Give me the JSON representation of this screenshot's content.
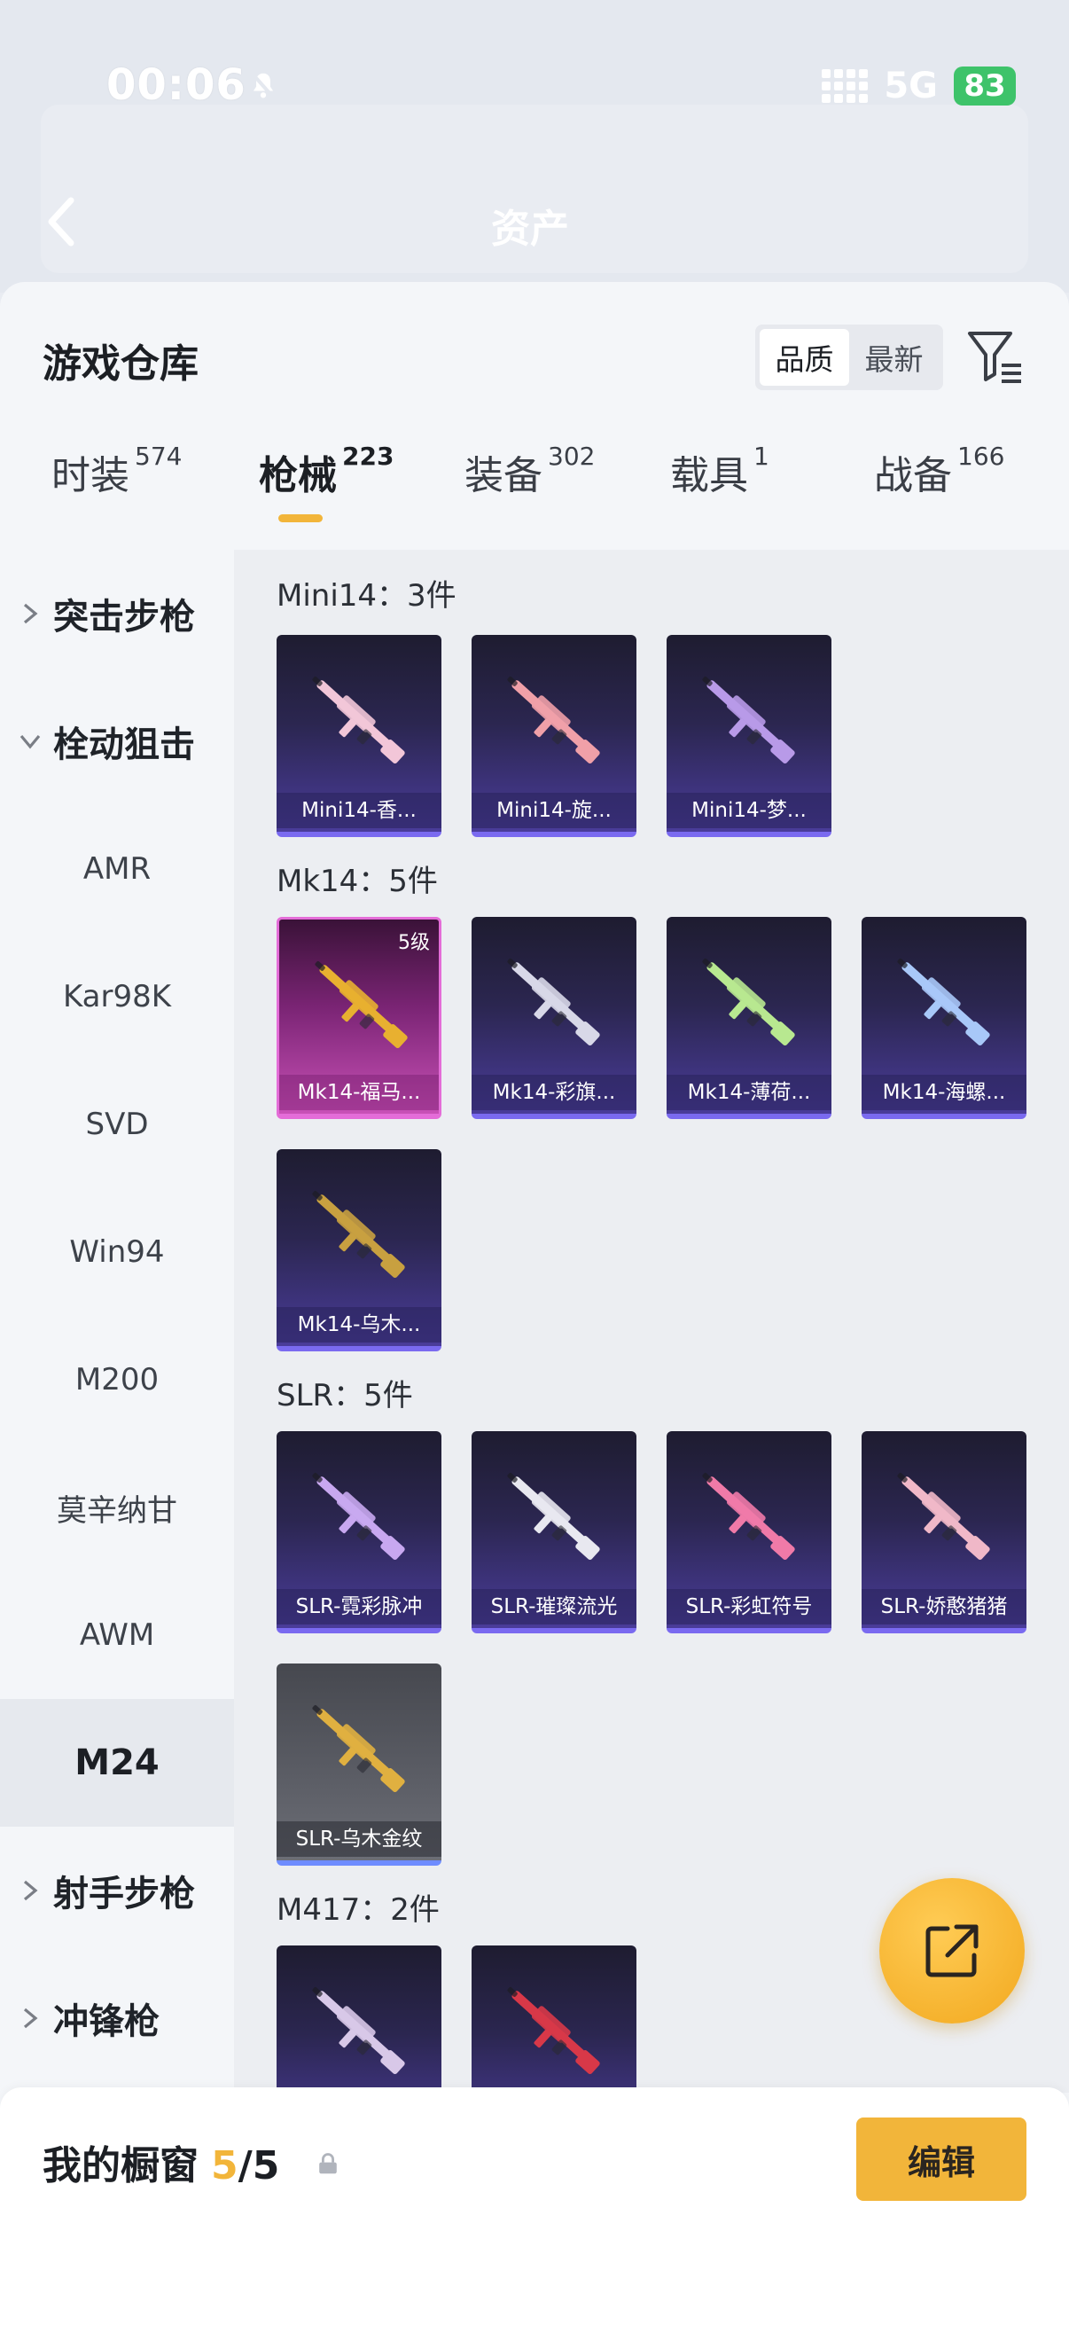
{
  "status_bar": {
    "time": "00:06",
    "network": "5G",
    "battery": "83"
  },
  "background": {
    "page_title": "资产"
  },
  "sheet": {
    "title": "游戏仓库",
    "sort": {
      "options": [
        "品质",
        "最新"
      ],
      "active": "品质"
    }
  },
  "tabs": [
    {
      "label": "时装",
      "count": "574"
    },
    {
      "label": "枪械",
      "count": "223",
      "active": true
    },
    {
      "label": "装备",
      "count": "302"
    },
    {
      "label": "载具",
      "count": "1"
    },
    {
      "label": "战备",
      "count": "166"
    }
  ],
  "sidebar": {
    "items": [
      {
        "label": "突击步枪",
        "type": "group",
        "expanded": false
      },
      {
        "label": "栓动狙击",
        "type": "group",
        "expanded": true
      },
      {
        "label": "AMR"
      },
      {
        "label": "Kar98K"
      },
      {
        "label": "SVD"
      },
      {
        "label": "Win94"
      },
      {
        "label": "M200"
      },
      {
        "label": "莫辛纳甘"
      },
      {
        "label": "AWM"
      },
      {
        "label": "M24",
        "selected": true
      },
      {
        "label": "射手步枪",
        "type": "group",
        "expanded": false
      },
      {
        "label": "冲锋枪",
        "type": "group",
        "expanded": false
      }
    ]
  },
  "sections": [
    {
      "title": "Mini14：3件",
      "items": [
        {
          "name": "Mini14-香...",
          "style": "purple",
          "accent": "#f2c6d8"
        },
        {
          "name": "Mini14-旋...",
          "style": "purple",
          "accent": "#f0a0a8"
        },
        {
          "name": "Mini14-梦...",
          "style": "purple",
          "accent": "#b89ae8"
        }
      ]
    },
    {
      "title": "Mk14：5件",
      "items": [
        {
          "name": "Mk14-福马...",
          "style": "pink",
          "level": "5级",
          "accent": "#e8b030"
        },
        {
          "name": "Mk14-彩旗...",
          "style": "purple",
          "accent": "#d8d8e8"
        },
        {
          "name": "Mk14-薄荷...",
          "style": "purple",
          "accent": "#b8e890"
        },
        {
          "name": "Mk14-海螺...",
          "style": "purple",
          "accent": "#a8c8f8"
        },
        {
          "name": "Mk14-乌木...",
          "style": "purple",
          "accent": "#c8a040"
        }
      ]
    },
    {
      "title": "SLR：5件",
      "items": [
        {
          "name": "SLR-霓彩脉冲",
          "style": "purple",
          "accent": "#c8a8f0"
        },
        {
          "name": "SLR-璀璨流光",
          "style": "purple",
          "accent": "#e8e8f0"
        },
        {
          "name": "SLR-彩虹符号",
          "style": "purple",
          "accent": "#f07aa8"
        },
        {
          "name": "SLR-娇憨猪猪",
          "style": "purple",
          "accent": "#f0b8c8"
        },
        {
          "name": "SLR-乌木金纹",
          "style": "gray",
          "accent": "#e0b040"
        }
      ]
    },
    {
      "title": "M417：2件",
      "items": [
        {
          "name": "",
          "style": "purple",
          "accent": "#d8c8e8"
        },
        {
          "name": "",
          "style": "purple",
          "accent": "#d83848"
        }
      ]
    }
  ],
  "bottom_bar": {
    "label": "我的橱窗",
    "count_current": "5",
    "separator": "/",
    "count_max": "5",
    "edit_label": "编辑"
  },
  "colors": {
    "accent": "#f2b53a",
    "battery": "#3ec36a",
    "card_border": "#7a6af0"
  }
}
